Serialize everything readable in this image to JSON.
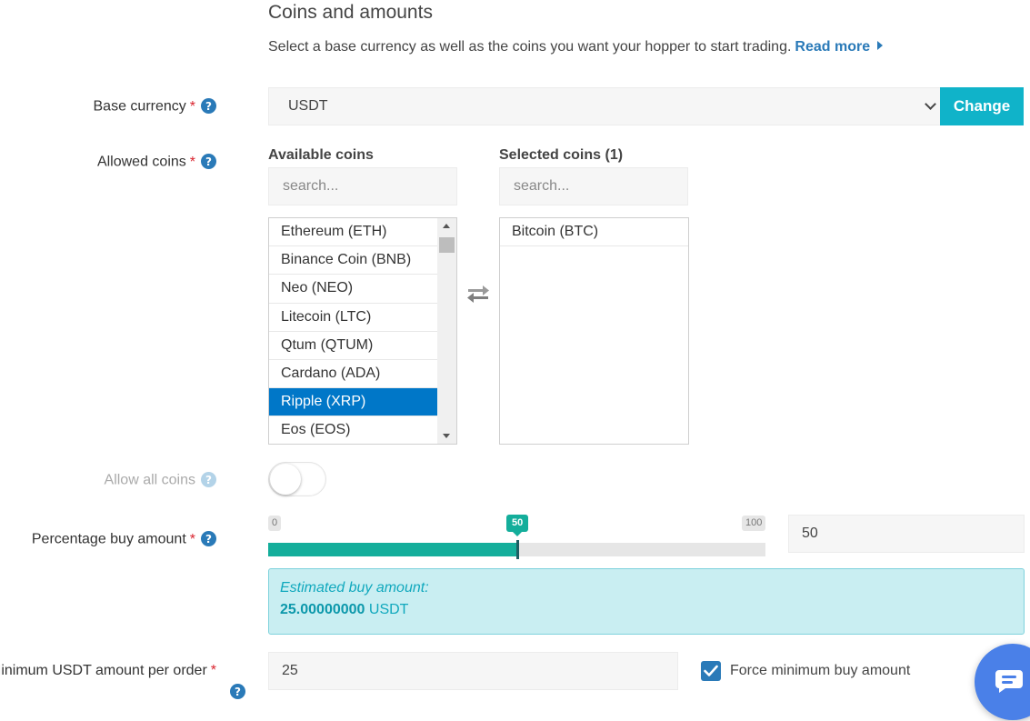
{
  "section": {
    "title": "Coins and amounts",
    "description": "Select a base currency as well as the coins you want your hopper to start trading.",
    "read_more": "Read more"
  },
  "base_currency": {
    "label": "Base currency",
    "required_mark": "*",
    "selected": "USDT",
    "change_button": "Change"
  },
  "allowed_coins": {
    "label": "Allowed coins",
    "required_mark": "*",
    "available": {
      "heading": "Available coins",
      "search_placeholder": "search...",
      "items": [
        "Ethereum (ETH)",
        "Binance Coin (BNB)",
        "Neo (NEO)",
        "Litecoin (LTC)",
        "Qtum (QTUM)",
        "Cardano (ADA)",
        "Ripple (XRP)",
        "Eos (EOS)"
      ],
      "selected_item": "Ripple (XRP)"
    },
    "selected": {
      "heading": "Selected coins (1)",
      "search_placeholder": "search...",
      "items": [
        "Bitcoin (BTC)"
      ]
    }
  },
  "allow_all_coins": {
    "label": "Allow all coins",
    "enabled": false
  },
  "percentage_buy": {
    "label": "Percentage buy amount",
    "required_mark": "*",
    "min_label": "0",
    "max_label": "100",
    "value_label": "50",
    "value_percent": 50,
    "input_value": "50",
    "estimate_label": "Estimated buy amount:",
    "estimate_value": "25.00000000",
    "estimate_unit": "USDT"
  },
  "minimum_amount": {
    "label": "Minimum USDT amount per order",
    "required_mark": "*",
    "input_value": "25",
    "force_label": "Force minimum buy amount",
    "force_checked": true
  },
  "colors": {
    "accent": "#10b3c9",
    "link": "#2a7ab8",
    "slider": "#14ae9b",
    "list_selected": "#0077c8",
    "required": "#d9232e",
    "chat": "#4a80e8"
  },
  "icons": {
    "help": "question-circle-icon",
    "swap": "swap-arrows-icon",
    "chat": "chat-icon",
    "check": "checkmark-icon"
  }
}
